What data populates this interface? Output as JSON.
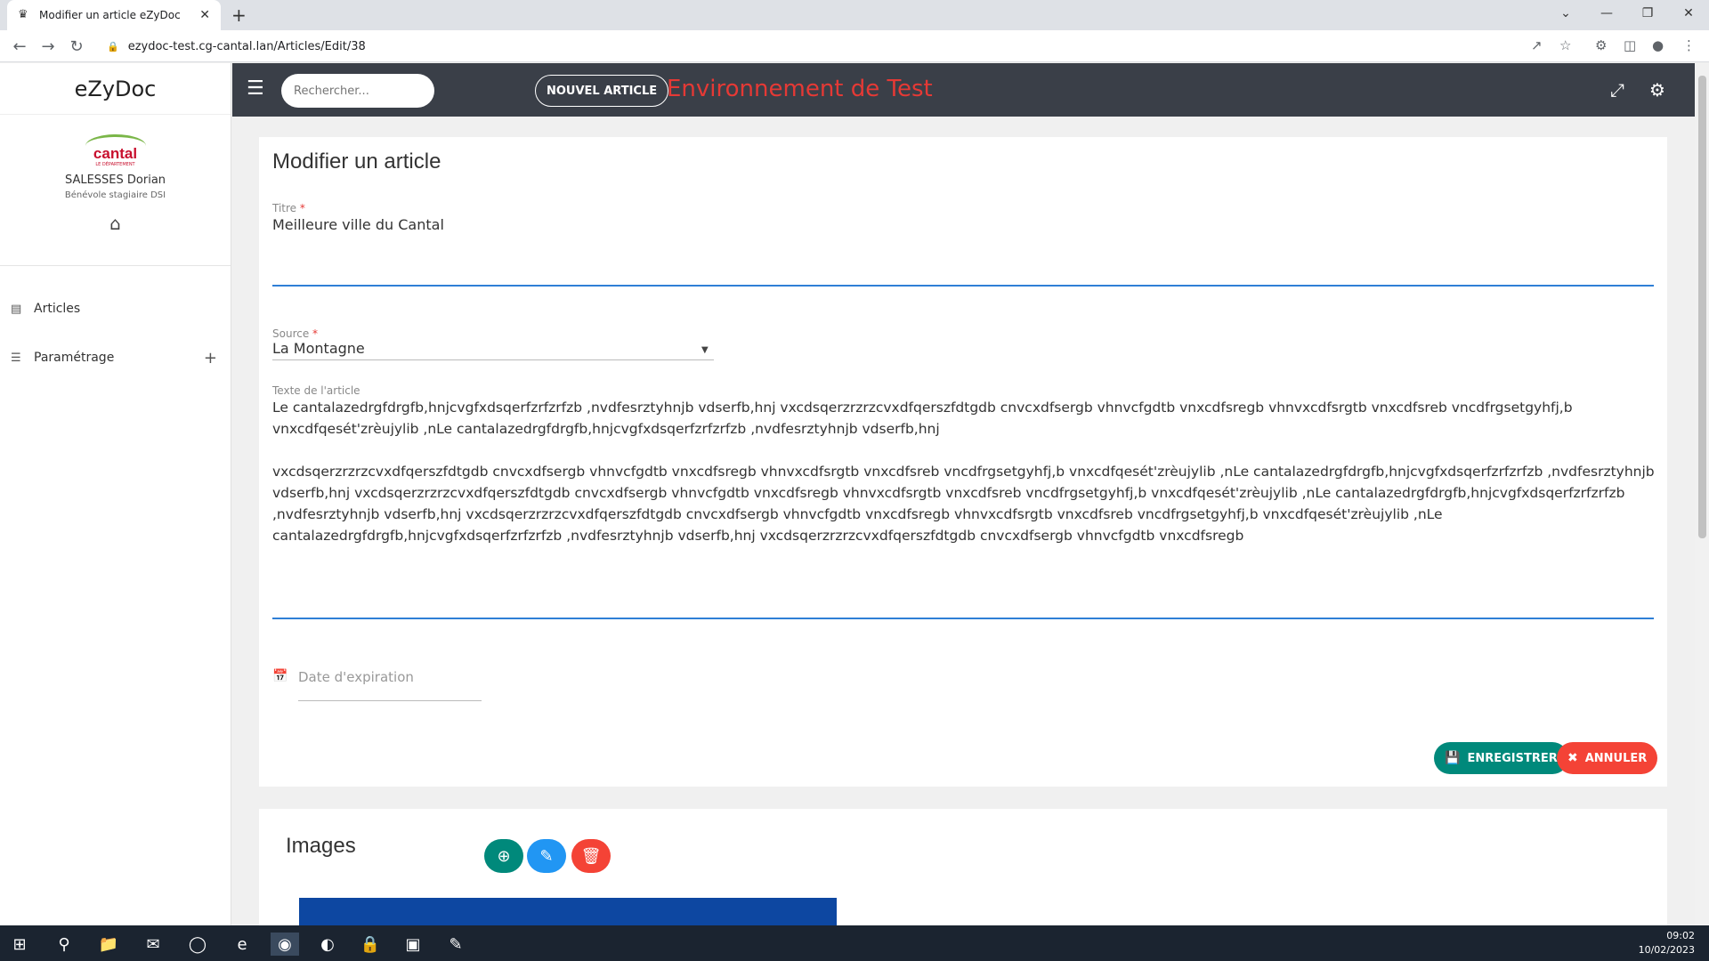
{
  "browser": {
    "tab_title": "Modifier un article eZyDoc",
    "url": "ezydoc-test.cg-cantal.lan/Articles/Edit/38"
  },
  "sidebar": {
    "brand": "eZyDoc",
    "logo_text": "cantal",
    "logo_sub": "LE DÉPARTEMENT",
    "user_name": "SALESSES Dorian",
    "user_role": "Bénévole stagiaire DSI",
    "items": [
      {
        "label": "Articles",
        "icon": "document-icon"
      },
      {
        "label": "Paramétrage",
        "icon": "list-icon"
      }
    ]
  },
  "topbar": {
    "search_placeholder": "Rechercher...",
    "new_article_label": "NOUVEL ARTICLE",
    "environment_label": "Environnement de Test"
  },
  "form": {
    "heading": "Modifier un article",
    "title_label": "Titre",
    "title_value": "Meilleure ville du Cantal",
    "source_label": "Source",
    "source_value": "La Montagne",
    "text_label": "Texte de l'article",
    "text_value": "Le cantalazedrgfdrgfb,hnjcvgfxdsqerfzrfzrfzb ,nvdfesrztyhnjb vdserfb,hnj vxcdsqerzrzrzcvxdfqerszfdtgdb cnvcxdfsergb vhnvcfgdtb vnxcdfsregb vhnvxcdfsrgtb vnxcdfsreb vncdfrgsetgyhfj,b vnxcdfqesét'zrèujylib ,nLe cantalazedrgfdrgfb,hnjcvgfxdsqerfzrfzrfzb ,nvdfesrztyhnjb vdserfb,hnj\n\nvxcdsqerzrzrzcvxdfqerszfdtgdb cnvcxdfsergb vhnvcfgdtb vnxcdfsregb vhnvxcdfsrgtb vnxcdfsreb vncdfrgsetgyhfj,b vnxcdfqesét'zrèujylib ,nLe cantalazedrgfdrgfb,hnjcvgfxdsqerfzrfzrfzb ,nvdfesrztyhnjb vdserfb,hnj vxcdsqerzrzrzcvxdfqerszfdtgdb cnvcxdfsergb vhnvcfgdtb vnxcdfsregb vhnvxcdfsrgtb vnxcdfsreb vncdfrgsetgyhfj,b vnxcdfqesét'zrèujylib ,nLe cantalazedrgfdrgfb,hnjcvgfxdsqerfzrfzrfzb ,nvdfesrztyhnjb vdserfb,hnj vxcdsqerzrzrzcvxdfqerszfdtgdb cnvcxdfsergb vhnvcfgdtb vnxcdfsregb vhnvxcdfsrgtb vnxcdfsreb vncdfrgsetgyhfj,b vnxcdfqesét'zrèujylib ,nLe cantalazedrgfdrgfb,hnjcvgfxdsqerfzrfzrfzb ,nvdfesrztyhnjb vdserfb,hnj vxcdsqerzrzrzcvxdfqerszfdtgdb cnvcxdfsergb vhnvcfgdtb vnxcdfsregb",
    "date_placeholder": "Date d'expiration",
    "save_label": "ENREGISTRER",
    "cancel_label": "ANNULER"
  },
  "images": {
    "heading": "Images"
  },
  "taskbar": {
    "time": "09:02",
    "date": "10/02/2023"
  },
  "colors": {
    "topbar": "#3a3f48",
    "environment": "#e53935",
    "save": "#00897b",
    "cancel": "#f44336",
    "edit": "#2196f3"
  }
}
